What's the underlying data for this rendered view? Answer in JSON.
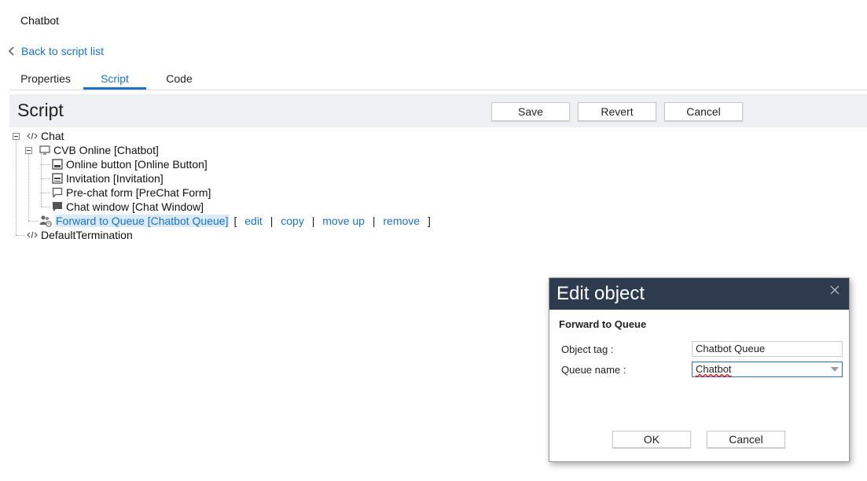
{
  "app": {
    "title": "Chatbot"
  },
  "nav": {
    "back_label": "Back to script list"
  },
  "tabs": [
    {
      "label": "Properties",
      "active": false
    },
    {
      "label": "Script",
      "active": true
    },
    {
      "label": "Code",
      "active": false
    }
  ],
  "toolbar": {
    "title": "Script",
    "save_label": "Save",
    "revert_label": "Revert",
    "cancel_label": "Cancel"
  },
  "tree": {
    "chat": {
      "label": "Chat",
      "icon": "code-icon"
    },
    "cvb": {
      "label": "CVB Online [Chatbot]",
      "icon": "monitor-icon"
    },
    "children": [
      {
        "label": "Online button [Online Button]",
        "icon": "online-button-icon"
      },
      {
        "label": "Invitation [Invitation]",
        "icon": "invitation-icon"
      },
      {
        "label": "Pre-chat form [PreChat Form]",
        "icon": "speech-bubble-outline-icon"
      },
      {
        "label": "Chat window [Chat Window]",
        "icon": "speech-bubble-filled-icon"
      }
    ],
    "selected": {
      "label": "Forward to Queue [Chatbot Queue]",
      "icon": "queue-users-icon",
      "bracket_open": "[",
      "bracket_close": "]",
      "sep": "|",
      "actions": {
        "edit": "edit",
        "copy": "copy",
        "move_up": "move up",
        "remove": "remove"
      }
    },
    "termination": {
      "label": "DefaultTermination",
      "icon": "code-icon"
    }
  },
  "dialog": {
    "title": "Edit object",
    "subtitle": "Forward to Queue",
    "object_tag_label": "Object tag :",
    "object_tag_value": "Chatbot Queue",
    "queue_name_label": "Queue name :",
    "queue_name_value": "Chatbot",
    "ok_label": "OK",
    "cancel_label": "Cancel"
  },
  "colors": {
    "accent": "#1a73c9",
    "dialog_header": "#2e3b4e",
    "toolbar_bg": "#eef0f3",
    "selection_bg": "#dbeaf7"
  }
}
